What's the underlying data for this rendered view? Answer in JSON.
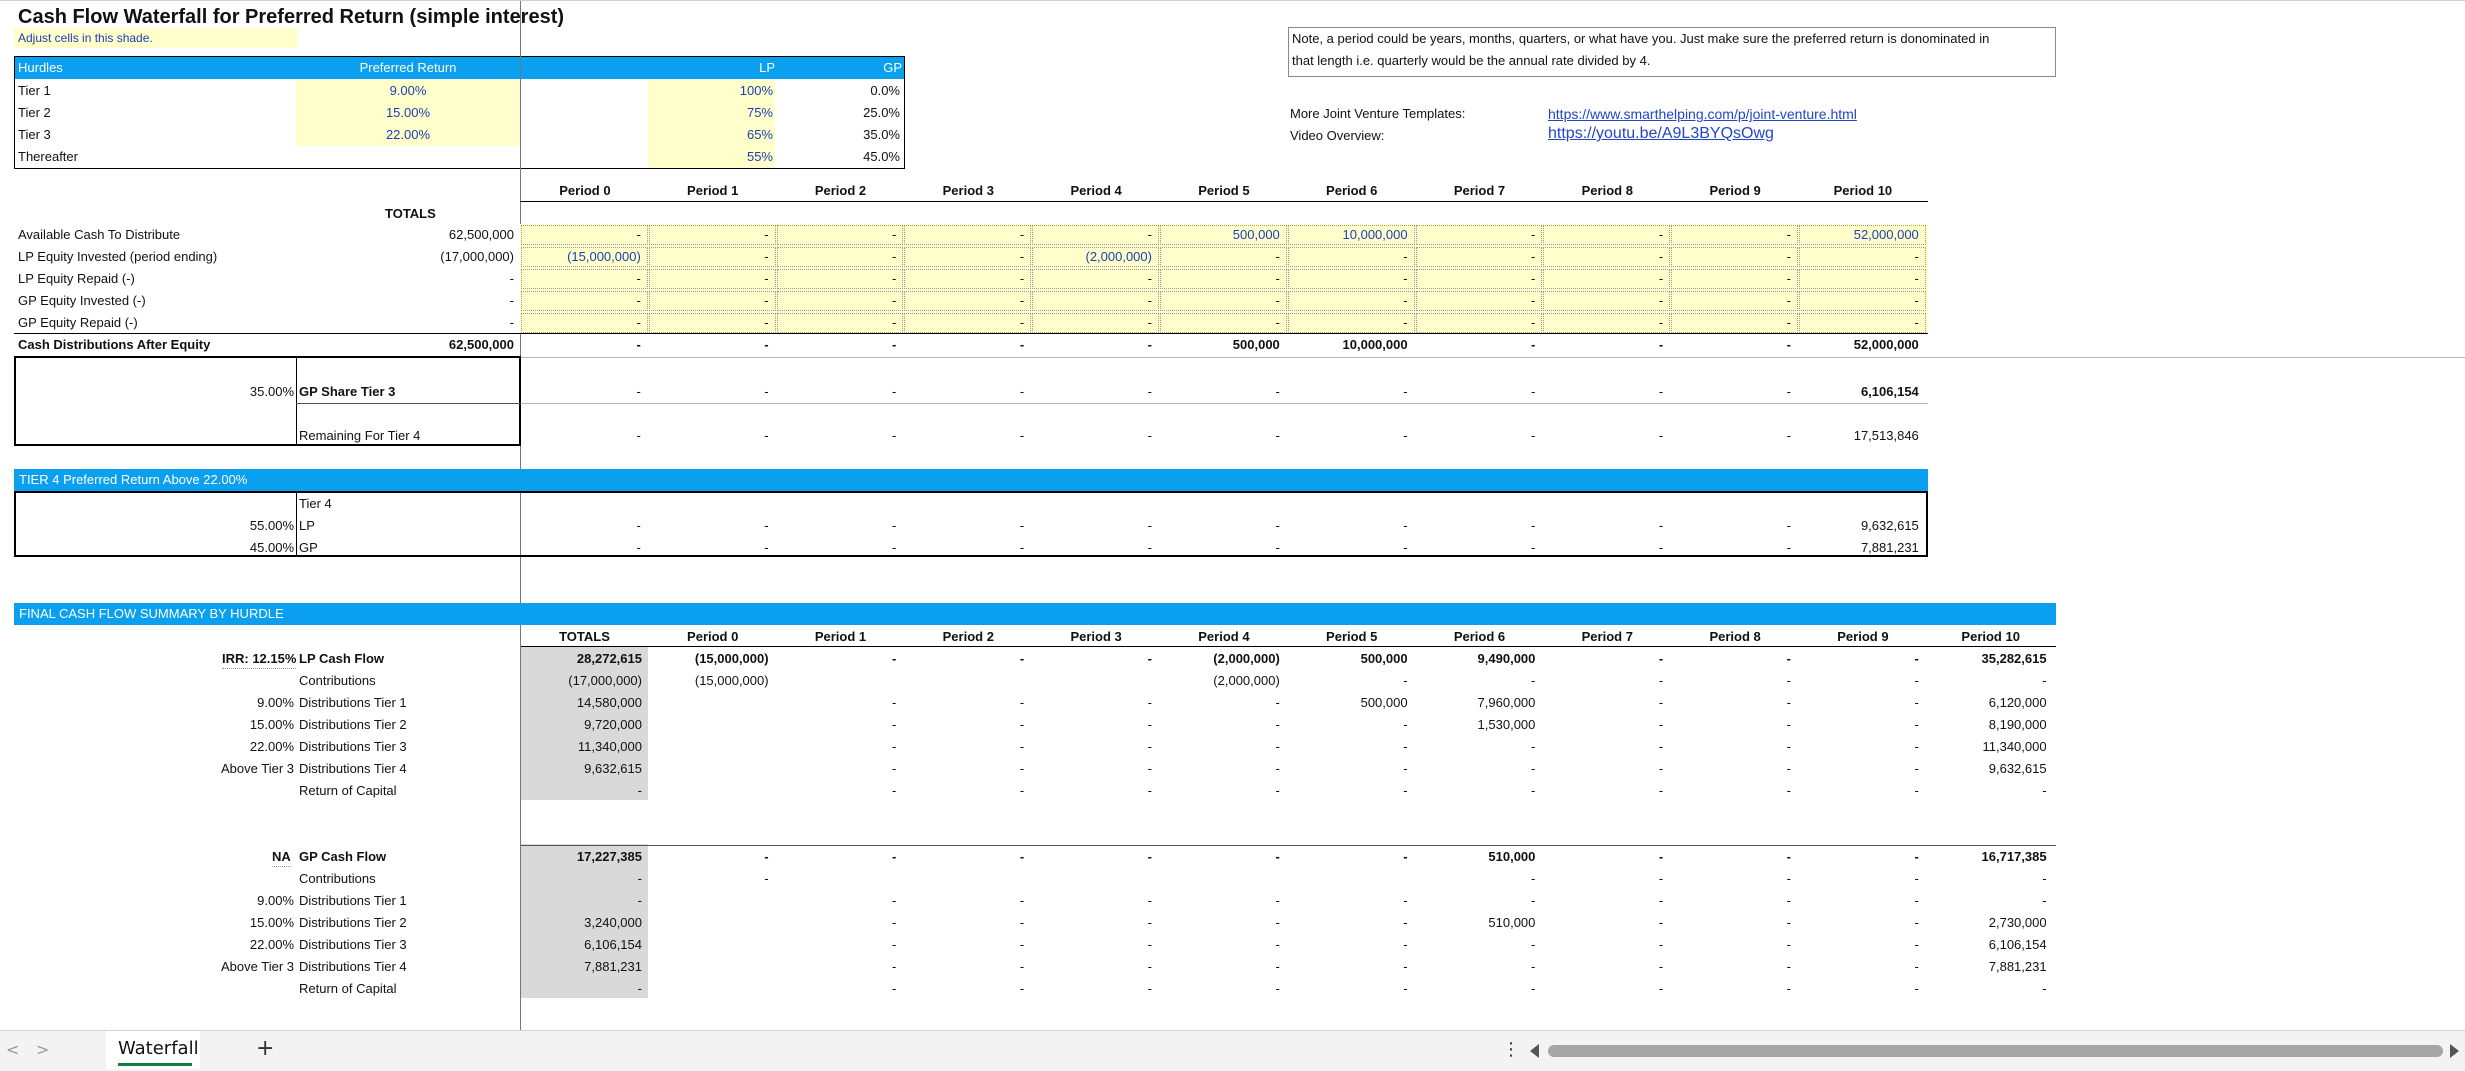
{
  "title": "Cash Flow Waterfall for Preferred Return (simple interest)",
  "adjust_note": "Adjust cells in this shade.",
  "note_text_1": "Note, a period could be years, months, quarters, or what have you. Just make sure the preferred return is donominated in",
  "note_text_2": "that length i.e. quarterly would be the annual rate divided by 4.",
  "links": {
    "templates_label": "More Joint Venture Templates:",
    "templates_url": "https://www.smarthelping.com/p/joint-venture.html",
    "video_label": "Video Overview:",
    "video_url": "https://youtu.be/A9L3BYQsOwg"
  },
  "hurdles": {
    "header": [
      "Hurdles",
      "Preferred Return",
      "LP",
      "GP"
    ],
    "rows": [
      {
        "name": "Tier 1",
        "pref": "9.00%",
        "lp": "100%",
        "gp": "0.0%"
      },
      {
        "name": "Tier 2",
        "pref": "15.00%",
        "lp": "75%",
        "gp": "25.0%"
      },
      {
        "name": "Tier 3",
        "pref": "22.00%",
        "lp": "65%",
        "gp": "35.0%"
      },
      {
        "name": "Thereafter",
        "pref": "",
        "lp": "55%",
        "gp": "45.0%"
      }
    ]
  },
  "periods": [
    "Period 0",
    "Period 1",
    "Period 2",
    "Period 3",
    "Period 4",
    "Period 5",
    "Period 6",
    "Period 7",
    "Period 8",
    "Period 9",
    "Period 10"
  ],
  "totals_label": "TOTALS",
  "cash_rows": [
    {
      "label": "Available Cash To Distribute",
      "bold": false,
      "total": "62,500,000",
      "cells": [
        "-",
        "-",
        "-",
        "-",
        "-",
        "500,000",
        "10,000,000",
        "-",
        "-",
        "-",
        "52,000,000"
      ]
    },
    {
      "label": "LP Equity Invested (period ending)",
      "bold": false,
      "total": "(17,000,000)",
      "cells": [
        "(15,000,000)",
        "-",
        "-",
        "-",
        "(2,000,000)",
        "-",
        "-",
        "-",
        "-",
        "-",
        "-"
      ]
    },
    {
      "label": "LP Equity Repaid (-)",
      "bold": false,
      "total": "-",
      "cells": [
        "-",
        "-",
        "-",
        "-",
        "-",
        "-",
        "-",
        "-",
        "-",
        "-",
        "-"
      ]
    },
    {
      "label": "GP Equity Invested (-)",
      "bold": false,
      "total": "-",
      "cells": [
        "-",
        "-",
        "-",
        "-",
        "-",
        "-",
        "-",
        "-",
        "-",
        "-",
        "-"
      ]
    },
    {
      "label": "GP Equity Repaid (-)",
      "bold": false,
      "total": "-",
      "cells": [
        "-",
        "-",
        "-",
        "-",
        "-",
        "-",
        "-",
        "-",
        "-",
        "-",
        "-"
      ]
    },
    {
      "label": "Cash Distributions After Equity",
      "bold": true,
      "total": "62,500,000",
      "cells": [
        "-",
        "-",
        "-",
        "-",
        "-",
        "500,000",
        "10,000,000",
        "-",
        "-",
        "-",
        "52,000,000"
      ]
    }
  ],
  "tier3": {
    "pct": "35.00%",
    "gp_label": "GP Share Tier 3",
    "gp_cells": [
      "-",
      "-",
      "-",
      "-",
      "-",
      "-",
      "-",
      "-",
      "-",
      "-",
      "6,106,154"
    ],
    "rem_label": "Remaining For Tier 4",
    "rem_cells": [
      "-",
      "-",
      "-",
      "-",
      "-",
      "-",
      "-",
      "-",
      "-",
      "-",
      "17,513,846"
    ]
  },
  "tier4": {
    "bar_label": "TIER 4 Preferred Return Above 22.00%",
    "tier_label": "Tier 4",
    "lp_pct": "55.00%",
    "lp_label": "LP",
    "lp_cells": [
      "-",
      "-",
      "-",
      "-",
      "-",
      "-",
      "-",
      "-",
      "-",
      "-",
      "9,632,615"
    ],
    "gp_pct": "45.00%",
    "gp_label": "GP",
    "gp_cells": [
      "-",
      "-",
      "-",
      "-",
      "-",
      "-",
      "-",
      "-",
      "-",
      "-",
      "7,881,231"
    ]
  },
  "summary": {
    "bar_label": "FINAL CASH FLOW SUMMARY BY HURDLE",
    "totals_label": "TOTALS",
    "lp_irr": "IRR: 12.15%",
    "lp_rows": [
      {
        "pre": "",
        "label": "LP Cash Flow",
        "bold": true,
        "total": "28,272,615",
        "cells": [
          "(15,000,000)",
          "-",
          "-",
          "-",
          "(2,000,000)",
          "500,000",
          "9,490,000",
          "-",
          "-",
          "-",
          "35,282,615"
        ]
      },
      {
        "pre": "",
        "label": "Contributions",
        "bold": false,
        "total": "(17,000,000)",
        "cells": [
          "(15,000,000)",
          "",
          "",
          "",
          "(2,000,000)",
          "-",
          "-",
          "-",
          "-",
          "-",
          "-"
        ]
      },
      {
        "pre": "9.00%",
        "label": "Distributions Tier 1",
        "bold": false,
        "total": "14,580,000",
        "cells": [
          "",
          "-",
          "-",
          "-",
          "-",
          "500,000",
          "7,960,000",
          "-",
          "-",
          "-",
          "6,120,000"
        ]
      },
      {
        "pre": "15.00%",
        "label": "Distributions Tier 2",
        "bold": false,
        "total": "9,720,000",
        "cells": [
          "",
          "-",
          "-",
          "-",
          "-",
          "-",
          "1,530,000",
          "-",
          "-",
          "-",
          "8,190,000"
        ]
      },
      {
        "pre": "22.00%",
        "label": "Distributions Tier 3",
        "bold": false,
        "total": "11,340,000",
        "cells": [
          "",
          "-",
          "-",
          "-",
          "-",
          "-",
          "-",
          "-",
          "-",
          "-",
          "11,340,000"
        ]
      },
      {
        "pre": "Above Tier 3",
        "label": "Distributions Tier 4",
        "bold": false,
        "total": "9,632,615",
        "cells": [
          "",
          "-",
          "-",
          "-",
          "-",
          "-",
          "-",
          "-",
          "-",
          "-",
          "9,632,615"
        ]
      },
      {
        "pre": "",
        "label": "Return of Capital",
        "bold": false,
        "total": "-",
        "cells": [
          "",
          "-",
          "-",
          "-",
          "-",
          "-",
          "-",
          "-",
          "-",
          "-",
          "-"
        ]
      }
    ],
    "gp_irr": "NA",
    "gp_rows": [
      {
        "pre": "",
        "label": "GP Cash Flow",
        "bold": true,
        "total": "17,227,385",
        "cells": [
          "-",
          "-",
          "-",
          "-",
          "-",
          "-",
          "510,000",
          "-",
          "-",
          "-",
          "16,717,385"
        ]
      },
      {
        "pre": "",
        "label": "Contributions",
        "bold": false,
        "total": "-",
        "cells": [
          "-",
          "",
          "",
          "",
          "",
          "",
          "-",
          "-",
          "-",
          "-",
          "-"
        ]
      },
      {
        "pre": "9.00%",
        "label": "Distributions Tier 1",
        "bold": false,
        "total": "-",
        "cells": [
          "",
          "-",
          "-",
          "-",
          "-",
          "-",
          "-",
          "-",
          "-",
          "-",
          "-"
        ]
      },
      {
        "pre": "15.00%",
        "label": "Distributions Tier 2",
        "bold": false,
        "total": "3,240,000",
        "cells": [
          "",
          "-",
          "-",
          "-",
          "-",
          "-",
          "510,000",
          "-",
          "-",
          "-",
          "2,730,000"
        ]
      },
      {
        "pre": "22.00%",
        "label": "Distributions Tier 3",
        "bold": false,
        "total": "6,106,154",
        "cells": [
          "",
          "-",
          "-",
          "-",
          "-",
          "-",
          "-",
          "-",
          "-",
          "-",
          "6,106,154"
        ]
      },
      {
        "pre": "Above Tier 3",
        "label": "Distributions Tier 4",
        "bold": false,
        "total": "7,881,231",
        "cells": [
          "",
          "-",
          "-",
          "-",
          "-",
          "-",
          "-",
          "-",
          "-",
          "-",
          "7,881,231"
        ]
      },
      {
        "pre": "",
        "label": "Return of Capital",
        "bold": false,
        "total": "-",
        "cells": [
          "",
          "-",
          "-",
          "-",
          "-",
          "-",
          "-",
          "-",
          "-",
          "-",
          "-"
        ]
      }
    ]
  },
  "tabs": {
    "sheet_name": "Waterfall",
    "add_label": "+",
    "prev_label": "<",
    "next_label": ">",
    "more_label": "⋮"
  },
  "colors": {
    "accent": "#0aa0ef",
    "input_shade": "#ffffcc",
    "totals_shade": "#d9d9d9"
  }
}
